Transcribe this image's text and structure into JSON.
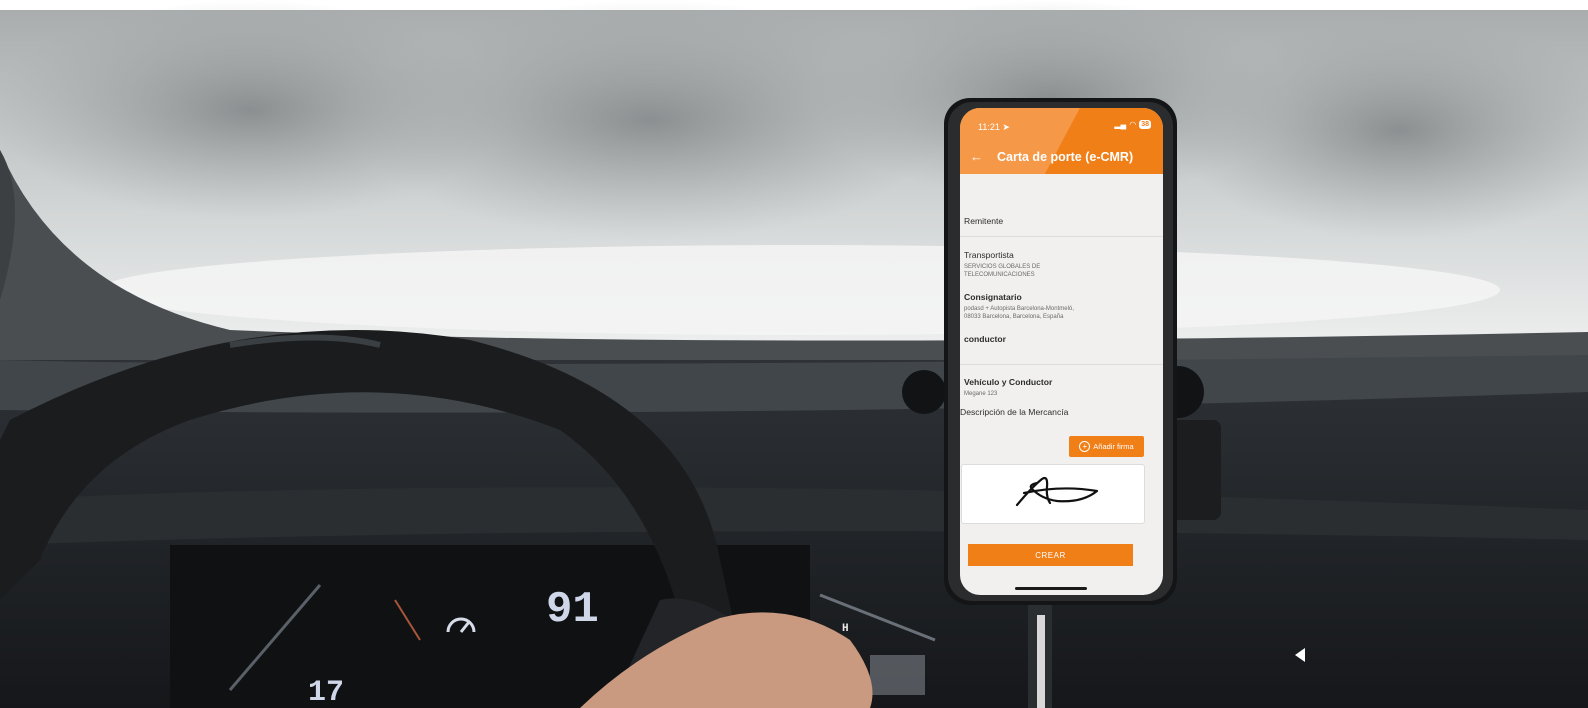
{
  "app": {
    "status_time": "11:21",
    "battery": "38",
    "title": "Carta de porte (e-CMR)",
    "sections": {
      "remitente": {
        "label": "Remitente"
      },
      "transportista": {
        "label": "Transportista",
        "lines": [
          "SERVICIOS GLOBALES DE",
          "TELECOMUNICACIONES"
        ]
      },
      "consignatario": {
        "label": "Consignatario",
        "lines": [
          "podasd + Autopista Barcelona-Montmeló,",
          "08033 Barcelona, Barcelona, España"
        ]
      },
      "conductor": {
        "label": "conductor"
      },
      "vehiculo": {
        "label": "Vehículo y Conductor",
        "value": "Megane 123"
      },
      "mercancia": {
        "label": "Descripción de la Mercancía"
      }
    },
    "add_signature_label": "Añadir firma",
    "create_label": "CREAR"
  },
  "dashboard": {
    "speed_readout": "91",
    "lower_readout": "17",
    "gear_letter": "H"
  },
  "colors": {
    "accent": "#f07f18",
    "screen_bg": "#f1f0ee",
    "windshield": "#d9dcdc"
  }
}
